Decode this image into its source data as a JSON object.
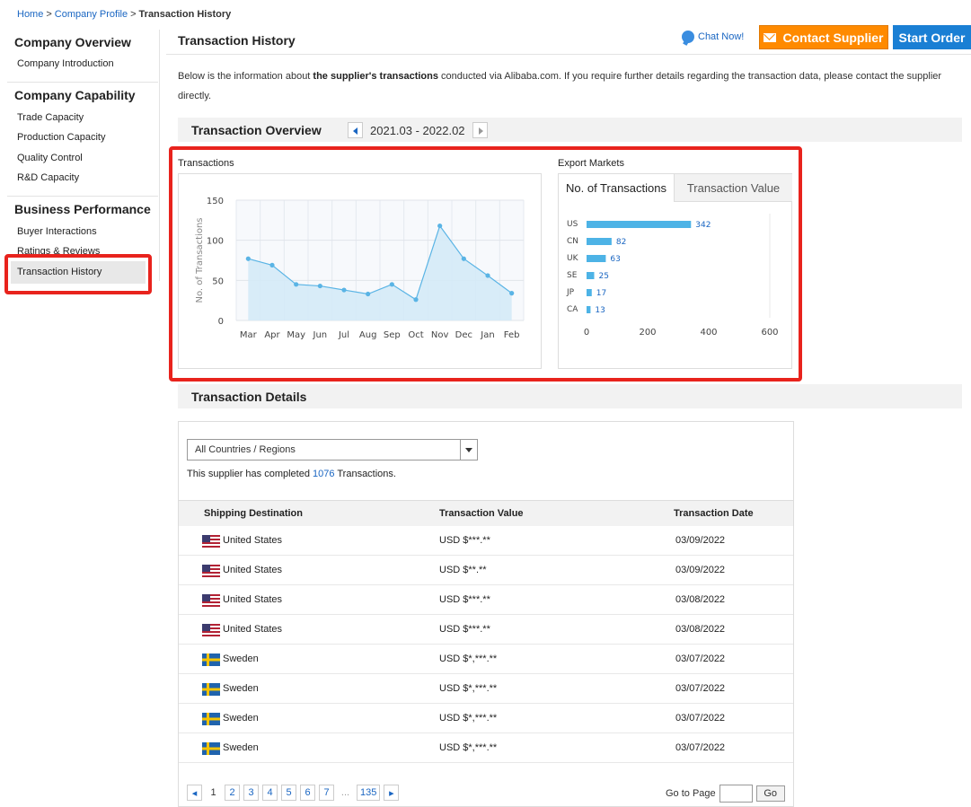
{
  "breadcrumb": {
    "items": [
      "Home",
      "Company Profile"
    ],
    "current": "Transaction History",
    "separator": ">"
  },
  "sidebar": {
    "groups": [
      {
        "title": "Company Overview",
        "items": [
          "Company Introduction"
        ]
      },
      {
        "title": "Company Capability",
        "items": [
          "Trade Capacity",
          "Production Capacity",
          "Quality Control",
          "R&D Capacity"
        ]
      },
      {
        "title": "Business Performance",
        "items": [
          "Buyer Interactions",
          "Ratings & Reviews",
          "Transaction History"
        ]
      }
    ],
    "active": "Transaction History"
  },
  "header": {
    "title": "Transaction History",
    "chat": "Chat Now!",
    "contact_button": "Contact Supplier",
    "start_order_button": "Start Order"
  },
  "intro": {
    "before": "Below is the information about ",
    "bold": "the supplier's transactions",
    "after": " conducted via Alibaba.com. If you require further details regarding the transaction data, please contact the supplier directly."
  },
  "overview": {
    "title": "Transaction Overview",
    "period": "2021.03 - 2022.02"
  },
  "chart_data": [
    {
      "type": "area",
      "title": "Transactions",
      "xlabel": "",
      "ylabel": "No. of Transactions",
      "x": [
        "Mar",
        "Apr",
        "May",
        "Jun",
        "Jul",
        "Aug",
        "Sep",
        "Oct",
        "Nov",
        "Dec",
        "Jan",
        "Feb"
      ],
      "values": [
        77,
        69,
        45,
        43,
        38,
        33,
        45,
        26,
        118,
        77,
        56,
        34
      ],
      "ylim": [
        0,
        150
      ],
      "yticks": [
        0,
        50,
        100,
        150
      ],
      "grid": true,
      "color": "#5ab4e5"
    },
    {
      "type": "bar",
      "orientation": "horizontal",
      "title": "Export Markets",
      "tabs": [
        "No. of Transactions",
        "Transaction Value"
      ],
      "active_tab": "No. of Transactions",
      "categories": [
        "US",
        "CN",
        "UK",
        "SE",
        "JP",
        "CA"
      ],
      "values": [
        342,
        82,
        63,
        25,
        17,
        13
      ],
      "xlim": [
        0,
        600
      ],
      "xticks": [
        0,
        200,
        400,
        600
      ],
      "color": "#4db3e6"
    }
  ],
  "details": {
    "title": "Transaction Details",
    "filter": "All Countries / Regions",
    "completed_before": "This supplier has completed ",
    "completed_count": "1076",
    "completed_after": " Transactions.",
    "columns": [
      "Shipping Destination",
      "Transaction Value",
      "Transaction Date"
    ],
    "rows": [
      {
        "flag": "us-flag-icon",
        "country": "United States",
        "value": "USD $***.**",
        "date": "03/09/2022"
      },
      {
        "flag": "us-flag-icon",
        "country": "United States",
        "value": "USD $**.**",
        "date": "03/09/2022"
      },
      {
        "flag": "us-flag-icon",
        "country": "United States",
        "value": "USD $***.**",
        "date": "03/08/2022"
      },
      {
        "flag": "us-flag-icon",
        "country": "United States",
        "value": "USD $***.**",
        "date": "03/08/2022"
      },
      {
        "flag": "se-flag-icon",
        "country": "Sweden",
        "value": "USD $*,***.**",
        "date": "03/07/2022"
      },
      {
        "flag": "se-flag-icon",
        "country": "Sweden",
        "value": "USD $*,***.**",
        "date": "03/07/2022"
      },
      {
        "flag": "se-flag-icon",
        "country": "Sweden",
        "value": "USD $*,***.**",
        "date": "03/07/2022"
      },
      {
        "flag": "se-flag-icon",
        "country": "Sweden",
        "value": "USD $*,***.**",
        "date": "03/07/2022"
      }
    ],
    "pager": {
      "pages": [
        "1",
        "2",
        "3",
        "4",
        "5",
        "6",
        "7"
      ],
      "current": "1",
      "ellipsis": "...",
      "last": "135",
      "goto_label": "Go to Page",
      "go_button": "Go"
    }
  },
  "colors": {
    "link": "#1a66c2",
    "contact": "#ff8a00",
    "start_order": "#1a7fd4",
    "highlight": "#e8231d"
  }
}
